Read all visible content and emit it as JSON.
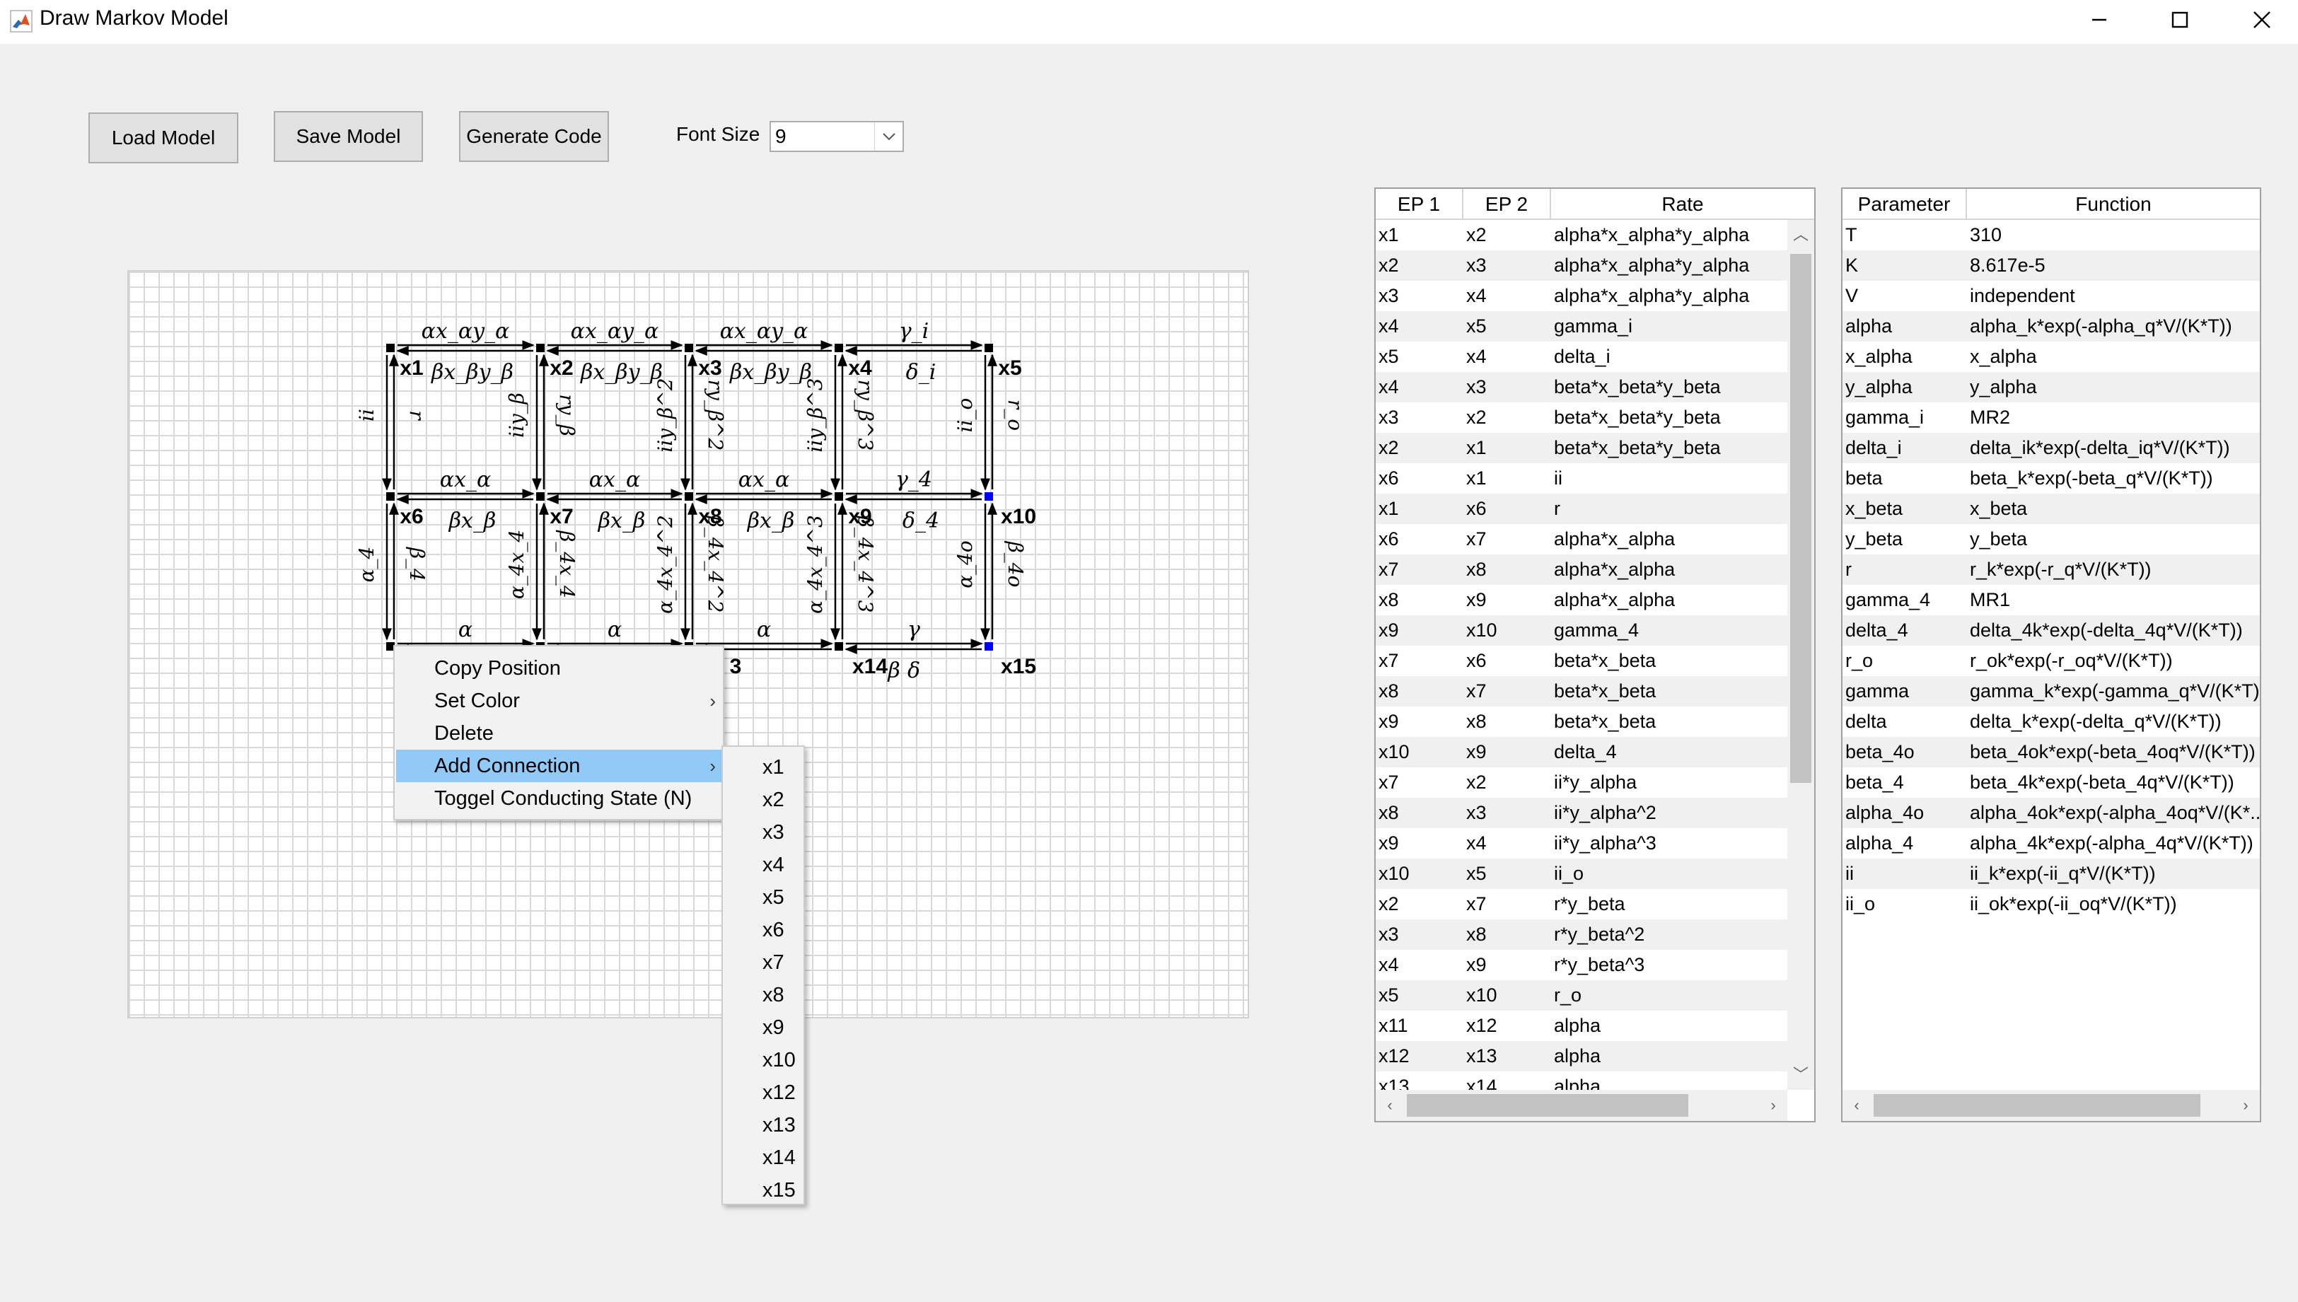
{
  "window": {
    "title": "Draw Markov Model",
    "icons": [
      "matlab-icon",
      "minimize-icon",
      "maximize-icon",
      "close-icon"
    ]
  },
  "toolbar": {
    "load_label": "Load Model",
    "save_label": "Save Model",
    "generate_label": "Generate Code",
    "font_size_label": "Font Size",
    "font_size_value": "9"
  },
  "diagram": {
    "nodes": [
      "x1",
      "x2",
      "x3",
      "x4",
      "x5",
      "x6",
      "x7",
      "x8",
      "x9",
      "x10",
      "x11",
      "x12",
      "x13",
      "x14",
      "x15"
    ],
    "visible_node_labels": [
      "x1",
      "x2",
      "x3",
      "x4",
      "x5",
      "x6",
      "x7",
      "x8",
      "x9",
      "x10",
      "3",
      "x14",
      "x15"
    ],
    "row1_forward": [
      "αx_αy_α",
      "αx_αy_α",
      "αx_αy_α",
      "γ_i"
    ],
    "row1_backward": [
      "βx_βy_β",
      "βx_βy_β",
      "βx_βy_β",
      "δ_i"
    ],
    "row2_forward": [
      "αx_α",
      "αx_α",
      "αx_α",
      "γ_4"
    ],
    "row2_backward": [
      "βx_β",
      "βx_β",
      "βx_β",
      "δ_4"
    ],
    "row3_forward": [
      "α",
      "α",
      "α",
      "γ"
    ],
    "row3_backward": [
      "β",
      "δ"
    ],
    "vertical_top_down": [
      "ii",
      "iiy_β",
      "iiy_β^2",
      "iiy_β^3",
      "ii_o"
    ],
    "vertical_top_up": [
      "r",
      "ry_β",
      "ry_β^2",
      "ry_β^3",
      "r_o"
    ],
    "vertical_bottom_down": [
      "α_4",
      "α_4x_4",
      "α_4x_4^2",
      "α_4x_4^3",
      "α_4o"
    ],
    "vertical_bottom_up": [
      "β_4",
      "β_4x_4",
      "β_4x_4^2",
      "β_4x_4^3",
      "β_4o"
    ],
    "node_colors": {
      "default": "#000000",
      "selected": "#0000ff"
    }
  },
  "context_menu": {
    "items": [
      "Copy Position",
      "Set Color",
      "Delete",
      "Add Connection",
      "Toggel Conducting State (N)"
    ],
    "submenu": [
      "x1",
      "x2",
      "x3",
      "x4",
      "x5",
      "x6",
      "x7",
      "x8",
      "x9",
      "x10",
      "x12",
      "x13",
      "x14",
      "x15"
    ]
  },
  "rate_table": {
    "columns": [
      "EP 1",
      "EP 2",
      "Rate"
    ],
    "rows": [
      [
        "x1",
        "x2",
        "alpha*x_alpha*y_alpha"
      ],
      [
        "x2",
        "x3",
        "alpha*x_alpha*y_alpha"
      ],
      [
        "x3",
        "x4",
        "alpha*x_alpha*y_alpha"
      ],
      [
        "x4",
        "x5",
        "gamma_i"
      ],
      [
        "x5",
        "x4",
        "delta_i"
      ],
      [
        "x4",
        "x3",
        "beta*x_beta*y_beta"
      ],
      [
        "x3",
        "x2",
        "beta*x_beta*y_beta"
      ],
      [
        "x2",
        "x1",
        "beta*x_beta*y_beta"
      ],
      [
        "x6",
        "x1",
        "ii"
      ],
      [
        "x1",
        "x6",
        "r"
      ],
      [
        "x6",
        "x7",
        "alpha*x_alpha"
      ],
      [
        "x7",
        "x8",
        "alpha*x_alpha"
      ],
      [
        "x8",
        "x9",
        "alpha*x_alpha"
      ],
      [
        "x9",
        "x10",
        "gamma_4"
      ],
      [
        "x7",
        "x6",
        "beta*x_beta"
      ],
      [
        "x8",
        "x7",
        "beta*x_beta"
      ],
      [
        "x9",
        "x8",
        "beta*x_beta"
      ],
      [
        "x10",
        "x9",
        "delta_4"
      ],
      [
        "x7",
        "x2",
        "ii*y_alpha"
      ],
      [
        "x8",
        "x3",
        "ii*y_alpha^2"
      ],
      [
        "x9",
        "x4",
        "ii*y_alpha^3"
      ],
      [
        "x10",
        "x5",
        "ii_o"
      ],
      [
        "x2",
        "x7",
        "r*y_beta"
      ],
      [
        "x3",
        "x8",
        "r*y_beta^2"
      ],
      [
        "x4",
        "x9",
        "r*y_beta^3"
      ],
      [
        "x5",
        "x10",
        "r_o"
      ],
      [
        "x11",
        "x12",
        "alpha"
      ],
      [
        "x12",
        "x13",
        "alpha"
      ],
      [
        "x13",
        "x14",
        "alpha"
      ]
    ]
  },
  "param_table": {
    "columns": [
      "Parameter",
      "Function"
    ],
    "rows": [
      [
        "T",
        "310"
      ],
      [
        "K",
        "8.617e-5"
      ],
      [
        "V",
        "independent"
      ],
      [
        "alpha",
        "alpha_k*exp(-alpha_q*V/(K*T))"
      ],
      [
        "x_alpha",
        "x_alpha"
      ],
      [
        "y_alpha",
        "y_alpha"
      ],
      [
        "gamma_i",
        "MR2"
      ],
      [
        "delta_i",
        "delta_ik*exp(-delta_iq*V/(K*T))"
      ],
      [
        "beta",
        "beta_k*exp(-beta_q*V/(K*T))"
      ],
      [
        "x_beta",
        "x_beta"
      ],
      [
        "y_beta",
        "y_beta"
      ],
      [
        "r",
        "r_k*exp(-r_q*V/(K*T))"
      ],
      [
        "gamma_4",
        "MR1"
      ],
      [
        "delta_4",
        "delta_4k*exp(-delta_4q*V/(K*T))"
      ],
      [
        "r_o",
        "r_ok*exp(-r_oq*V/(K*T))"
      ],
      [
        "gamma",
        "gamma_k*exp(-gamma_q*V/(K*T))"
      ],
      [
        "delta",
        "delta_k*exp(-delta_q*V/(K*T))"
      ],
      [
        "beta_4o",
        "beta_4ok*exp(-beta_4oq*V/(K*T))"
      ],
      [
        "beta_4",
        "beta_4k*exp(-beta_4q*V/(K*T))"
      ],
      [
        "alpha_4o",
        "alpha_4ok*exp(-alpha_4oq*V/(K*..."
      ],
      [
        "alpha_4",
        "alpha_4k*exp(-alpha_4q*V/(K*T))"
      ],
      [
        "ii",
        "ii_k*exp(-ii_q*V/(K*T))"
      ],
      [
        "ii_o",
        "ii_ok*exp(-ii_oq*V/(K*T))"
      ]
    ]
  }
}
